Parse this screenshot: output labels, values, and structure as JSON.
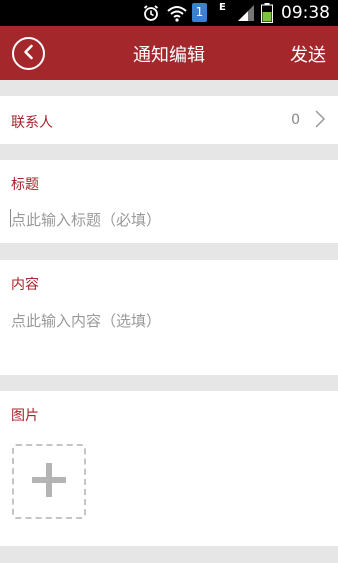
{
  "status_bar": {
    "time": "09:38",
    "sim_number": "1",
    "network": "E",
    "icons": [
      "alarm-icon",
      "wifi-icon",
      "sim-icon",
      "signal-icon",
      "battery-icon"
    ]
  },
  "header": {
    "title": "通知编辑",
    "send_label": "发送",
    "background": "#a3272b"
  },
  "contacts": {
    "label": "联系人",
    "count": "0"
  },
  "title_field": {
    "label": "标题",
    "placeholder": "点此输入标题（必填）"
  },
  "content_field": {
    "label": "内容",
    "placeholder": "点此输入内容（选填）"
  },
  "images": {
    "label": "图片"
  },
  "colors": {
    "accent": "#a3272b",
    "label_text": "#a3272b",
    "placeholder_text": "#9a9a9a",
    "divider": "#e6e6e6"
  }
}
